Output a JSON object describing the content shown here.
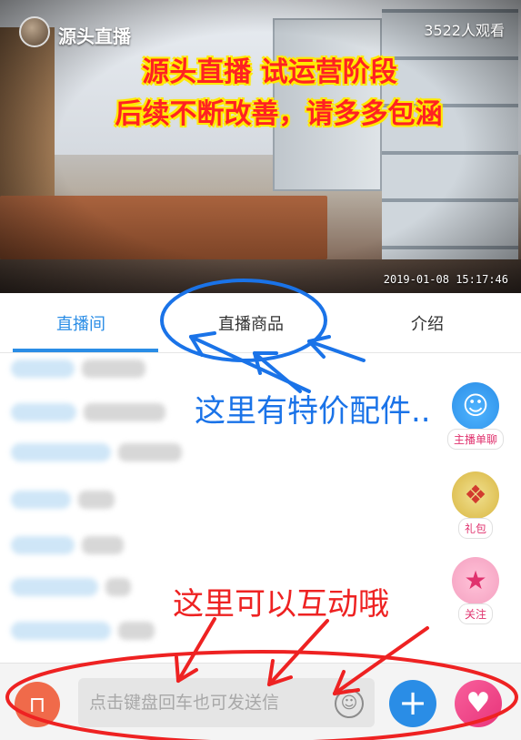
{
  "stream": {
    "anchor_name": "源头直播",
    "viewers": "3522人观看",
    "overlay_line1": "源头直播  试运营阶段",
    "overlay_line2": "后续不断改善，请多多包涵",
    "timestamp": "2019-01-08  15:17:46"
  },
  "tabs": [
    {
      "label": "直播间",
      "active": true
    },
    {
      "label": "直播商品",
      "active": false
    },
    {
      "label": "介绍",
      "active": false
    }
  ],
  "side_buttons": {
    "chat": {
      "label": "主播单聊",
      "icon": "chat-bubble-icon"
    },
    "gift": {
      "label": "礼包",
      "icon": "gift-icon"
    },
    "follow": {
      "label": "关注",
      "icon": "star-icon"
    }
  },
  "input": {
    "placeholder": "点击键盘回车也可发送信"
  },
  "annotations": {
    "blue_text": "这里有特价配件..",
    "red_text": "这里可以互动哦"
  },
  "colors": {
    "accent_blue": "#2a8de6",
    "annotation_blue": "#1a73e8",
    "annotation_red": "#ee2222",
    "heart_pink": "#e8347a"
  }
}
